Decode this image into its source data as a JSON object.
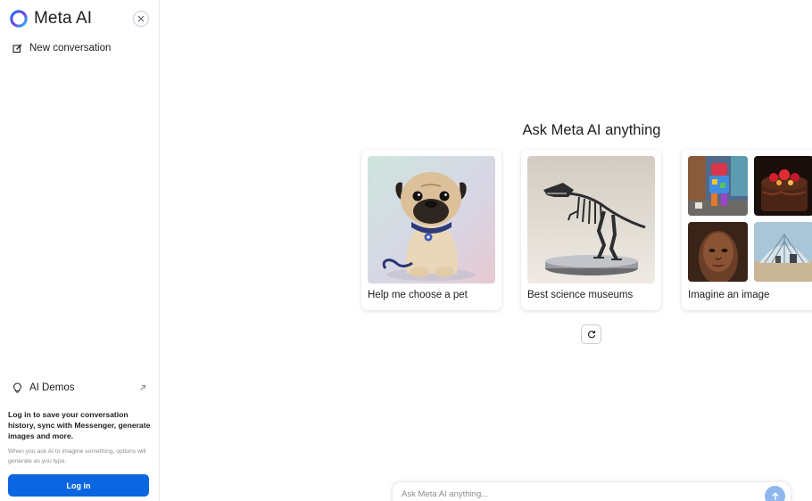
{
  "brand": {
    "name": "Meta AI",
    "logo_icon": "meta-ai-ring-icon"
  },
  "sidebar": {
    "close_icon": "close-icon",
    "new_conversation": {
      "label": "New conversation",
      "icon": "edit-icon"
    },
    "demos": {
      "label": "AI Demos",
      "icon": "lightbulb-icon",
      "arrow_icon": "external-arrow-icon"
    },
    "login": {
      "title": "Log in to save your conversation history, sync with Messenger, generate images and more.",
      "note": "When you ask AI to imagine something, options will generate as you type.",
      "button_label": "Log in"
    }
  },
  "main": {
    "heading": "Ask Meta AI anything",
    "cards": [
      {
        "caption": "Help me choose a pet",
        "image": "pug-photo"
      },
      {
        "caption": "Best science museums",
        "image": "dinosaur-skeleton-photo"
      },
      {
        "caption": "Imagine an image",
        "image": "image-collage"
      }
    ],
    "refresh_icon": "refresh-icon",
    "chat": {
      "placeholder": "Ask Meta AI anything...",
      "send_icon": "send-arrow-icon"
    }
  },
  "colors": {
    "accent": "#0a66e0",
    "send_disabled": "#8fb7ef",
    "border": "#e8eaed"
  }
}
